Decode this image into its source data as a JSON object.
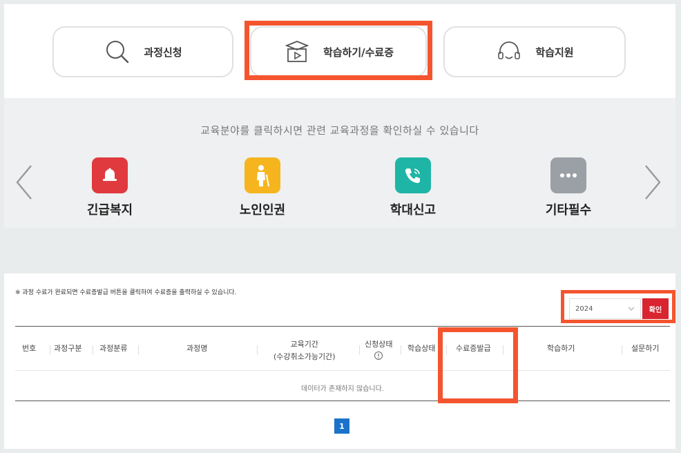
{
  "menu": {
    "course_apply": "과정신청",
    "learn_certificate": "학습하기/수료증",
    "learn_support": "학습지원"
  },
  "categories": {
    "guide": "교육분야를 클릭하시면 관련 교육과정을 확인하실 수 있습니다",
    "items": [
      {
        "label": "긴급복지",
        "color": "#e03a3e",
        "icon": "bell-icon"
      },
      {
        "label": "노인인권",
        "color": "#f6b51f",
        "icon": "elder-person-icon"
      },
      {
        "label": "학대신고",
        "color": "#1fb5a6",
        "icon": "phone-icon"
      },
      {
        "label": "기타필수",
        "color": "#9aa0a6",
        "icon": "more-icon"
      }
    ]
  },
  "course_table": {
    "notice": "※ 과정 수료가 완료되면 수료증발급 버튼을 클릭하여 수료증을 출력하실 수 있습니다.",
    "year": "2024",
    "confirm": "확인",
    "headers": {
      "no": "번호",
      "type": "과정구분",
      "category": "과정분류",
      "name": "과정명",
      "period": "교육기간",
      "period_sub": "(수강취소가능기간)",
      "apply_status": "신청상태",
      "learn_status": "학습상태",
      "certificate": "수료증발급",
      "learn": "학습하기",
      "survey": "설문하기"
    },
    "empty": "데이터가 존재하지 않습니다.",
    "page": "1"
  },
  "colors": {
    "highlight": "#f4552f",
    "confirm_button": "#d8252f",
    "page_active": "#1a73c9"
  }
}
